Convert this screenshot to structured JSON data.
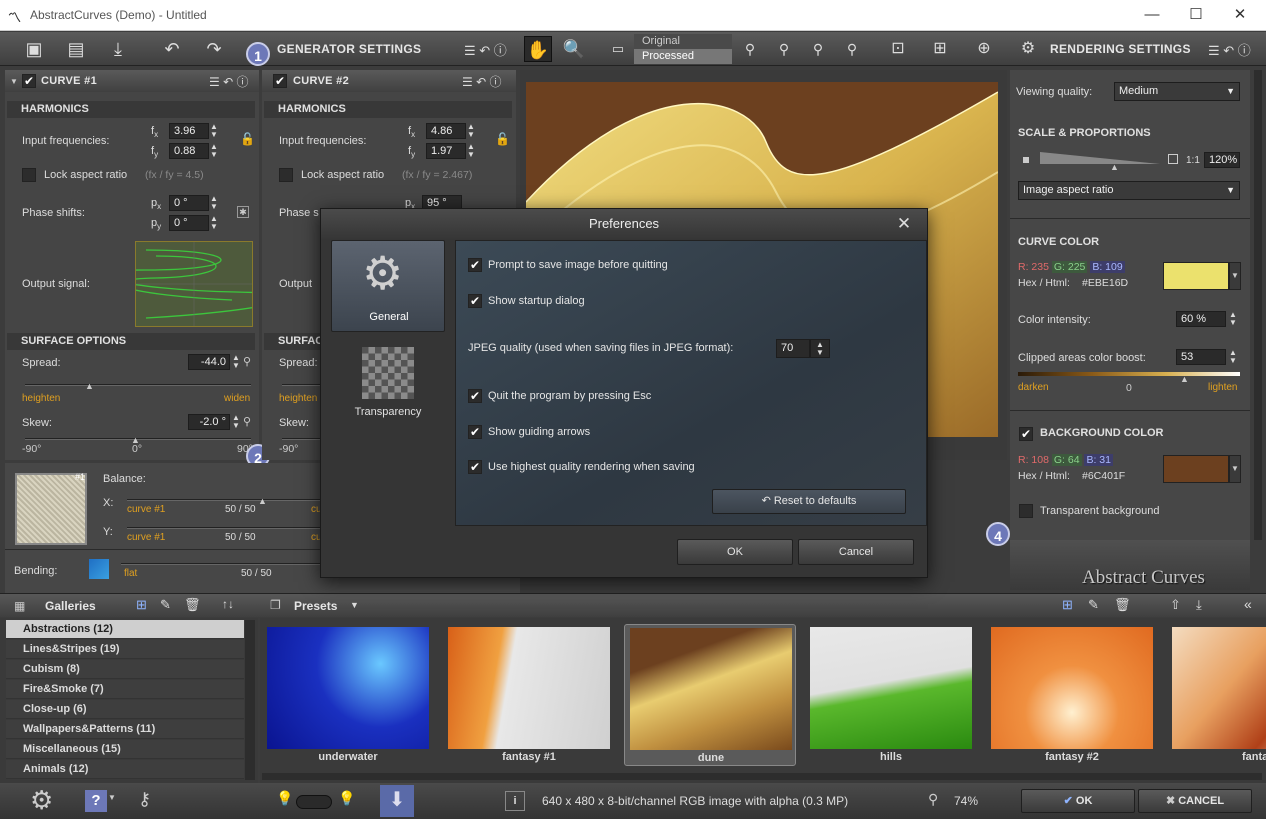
{
  "window": {
    "title": "AbstractCurves (Demo) - Untitled",
    "minimize": "—",
    "maximize": "☐",
    "close": "✕"
  },
  "generator": {
    "header": "GENERATOR SETTINGS",
    "step1": "1",
    "step2": "2"
  },
  "view": {
    "original": "Original",
    "processed": "Processed"
  },
  "curve1": {
    "title": "CURVE #1",
    "harmonics": "HARMONICS",
    "input_freq_label": "Input frequencies:",
    "fx_label": "f",
    "fx_sub": "x",
    "fx": "3.96",
    "fy_label": "f",
    "fy_sub": "y",
    "fy": "0.88",
    "lock_label": "Lock aspect ratio",
    "lock_note": "(fx / fy = 4.5)",
    "phase_label": "Phase shifts:",
    "px_label": "p",
    "px_sub": "x",
    "px": "0 °",
    "py_label": "p",
    "py_sub": "y",
    "py": "0 °",
    "output_label": "Output signal:",
    "surface": "SURFACE OPTIONS",
    "spread_label": "Spread:",
    "spread": "-44.0",
    "heighten": "heighten",
    "widen": "widen",
    "skew_label": "Skew:",
    "skew": "-2.0 °",
    "tick_left": "-90°",
    "tick_mid": "0°",
    "tick_right": "90°"
  },
  "curve2": {
    "title": "CURVE #2",
    "harmonics": "HARMONICS",
    "input_freq_label": "Input frequencies:",
    "fx_label": "f",
    "fx_sub": "x",
    "fx": "4.86",
    "fy_label": "f",
    "fy_sub": "y",
    "fy": "1.97",
    "lock_label": "Lock aspect ratio",
    "lock_note": "(fx / fy = 2.467)",
    "phase_label": "Phase s",
    "px_label": "p",
    "px_sub": "x",
    "px": "95 °",
    "output_label": "Output",
    "surface": "SURFAC",
    "spread_label": "Spread:",
    "heighten": "heighten",
    "skew_label": "Skew:",
    "tick_left": "-90°"
  },
  "balance": {
    "thumb_label": "#1",
    "title": "Balance:",
    "x_label": "X:",
    "x_left": "curve #1",
    "x_value": "50 / 50",
    "x_right": "cu",
    "y_label": "Y:",
    "y_left": "curve #1",
    "y_value": "50 / 50",
    "y_right": "cu",
    "bending_label": "Bending:",
    "bend_left": "flat",
    "bend_value": "50 / 50",
    "bend_right": "plasma"
  },
  "rendering": {
    "header": "RENDERING SETTINGS",
    "viewing_label": "Viewing quality:",
    "viewing_value": "Medium",
    "scale_header": "SCALE & PROPORTIONS",
    "ratio_label": "1:1",
    "zoom": "120%",
    "aspect": "Image aspect ratio",
    "curve_color_header": "CURVE COLOR",
    "r_label": "R: 235",
    "g_label": "G: 225",
    "b_label": "B: 109",
    "hex_label": "Hex / Html:",
    "hex": "#EBE16D",
    "curve_color": "#EBE16D",
    "intensity_label": "Color intensity:",
    "intensity": "60 %",
    "boost_label": "Clipped areas color boost:",
    "boost": "53",
    "darken": "darken",
    "zero": "0",
    "lighten": "lighten",
    "bg_header": "BACKGROUND COLOR",
    "bg_r": "R: 108",
    "bg_g": "G: 64",
    "bg_b": "B: 31",
    "bg_hex_label": "Hex / Html:",
    "bg_hex": "#6C401F",
    "bg_color": "#6C401F",
    "transparent_label": "Transparent background",
    "step4": "4",
    "logo": "Abstract Curves"
  },
  "preferences": {
    "title": "Preferences",
    "close": "✕",
    "tabs": [
      {
        "label": "General"
      },
      {
        "label": "Transparency"
      }
    ],
    "options": {
      "prompt_save": "Prompt to save image before quitting",
      "startup": "Show startup dialog",
      "jpeg_label": "JPEG quality (used when saving files in JPEG format):",
      "jpeg_value": "70",
      "quit_esc": "Quit the program by pressing Esc",
      "arrows": "Show guiding arrows",
      "hq": "Use highest quality rendering when saving"
    },
    "reset": "Reset to defaults",
    "ok": "OK",
    "cancel": "Cancel"
  },
  "galleries": {
    "title": "Galleries",
    "items": [
      {
        "label": "Abstractions (12)"
      },
      {
        "label": "Lines&Stripes (19)"
      },
      {
        "label": "Cubism (8)"
      },
      {
        "label": "Fire&Smoke (7)"
      },
      {
        "label": "Close-up (6)"
      },
      {
        "label": "Wallpapers&Patterns (11)"
      },
      {
        "label": "Miscellaneous (15)"
      },
      {
        "label": "Animals (12)"
      }
    ]
  },
  "presets": {
    "title": "Presets",
    "collapse": "«",
    "items": [
      {
        "label": "underwater"
      },
      {
        "label": "fantasy #1"
      },
      {
        "label": "dune"
      },
      {
        "label": "hills"
      },
      {
        "label": "fantasy #2"
      },
      {
        "label": "fantas"
      }
    ]
  },
  "status": {
    "info": "640 x 480 x 8-bit/channel RGB image with alpha  (0.3 MP)",
    "zoom": "74%",
    "ok": "OK",
    "cancel": "CANCEL"
  }
}
